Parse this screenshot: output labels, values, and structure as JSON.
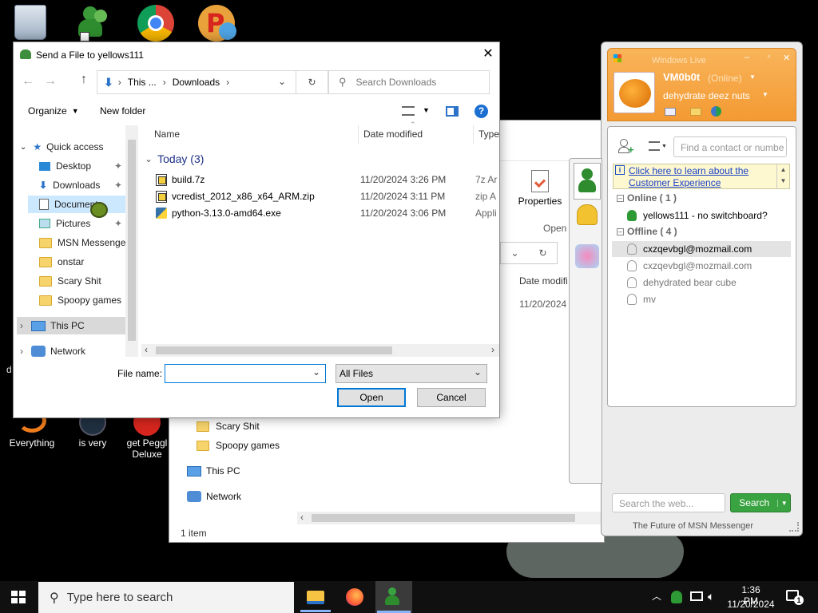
{
  "desktop": {
    "icons": [
      {
        "label": "Everything"
      },
      {
        "label": "is very"
      },
      {
        "label": "get Peggl Deluxe"
      }
    ],
    "partial_label": "d"
  },
  "explorer": {
    "toolbar": {
      "properties": "Properties",
      "open_group": "Open"
    },
    "column_date": "Date modifi",
    "row_date": "11/20/2024",
    "nav": [
      "Scary Shit",
      "Spoopy games",
      "This PC",
      "Network"
    ],
    "status": "1 item"
  },
  "dialog": {
    "title": "Send a File to yellows111",
    "close": "✕",
    "breadcrumb": [
      "This ...",
      "Downloads"
    ],
    "search_placeholder": "Search Downloads",
    "organize": "Organize",
    "new_folder": "New folder",
    "nav": {
      "quick_access": "Quick access",
      "items": [
        "Desktop",
        "Downloads",
        "Documents",
        "Pictures",
        "MSN Messenger",
        "onstar",
        "Scary Shit",
        "Spoopy games"
      ],
      "this_pc": "This PC",
      "network": "Network"
    },
    "columns": {
      "name": "Name",
      "date": "Date modified",
      "type": "Type"
    },
    "group": "Today (3)",
    "files": [
      {
        "name": "build.7z",
        "date": "11/20/2024 3:26 PM",
        "type": "7z Ar"
      },
      {
        "name": "vcredist_2012_x86_x64_ARM.zip",
        "date": "11/20/2024 3:11 PM",
        "type": "zip A"
      },
      {
        "name": "python-3.13.0-amd64.exe",
        "date": "11/20/2024 3:06 PM",
        "type": "Appli"
      }
    ],
    "file_name_label": "File name:",
    "file_name_value": "",
    "filter": "All Files",
    "open": "Open",
    "cancel": "Cancel"
  },
  "msn": {
    "window_title": "Windows Live",
    "username": "VM0b0t",
    "status": "(Online)",
    "personal_message": "dehydrate deez nuts",
    "find_placeholder": "Find a contact or numbe",
    "banner_link": "Click here to learn about the Customer Experience",
    "online_header": "Online ( 1 )",
    "online": [
      {
        "name": "yellows111 - no switchboard?"
      }
    ],
    "offline_header": "Offline ( 4 )",
    "offline": [
      {
        "name": "cxzqevbgl@mozmail.com"
      },
      {
        "name": "cxzqevbgl@mozmail.com"
      },
      {
        "name": "dehydrated bear cube"
      },
      {
        "name": "mv"
      }
    ],
    "web_search_placeholder": "Search the web...",
    "search_button": "Search",
    "footer": "The Future of MSN Messenger",
    "colors": {
      "accent": "#f7a541",
      "search_green": "#3aa341"
    }
  },
  "taskbar": {
    "search_placeholder": "Type here to search",
    "time": "1:36 PM",
    "date": "11/20/2024",
    "notification_count": "1"
  }
}
